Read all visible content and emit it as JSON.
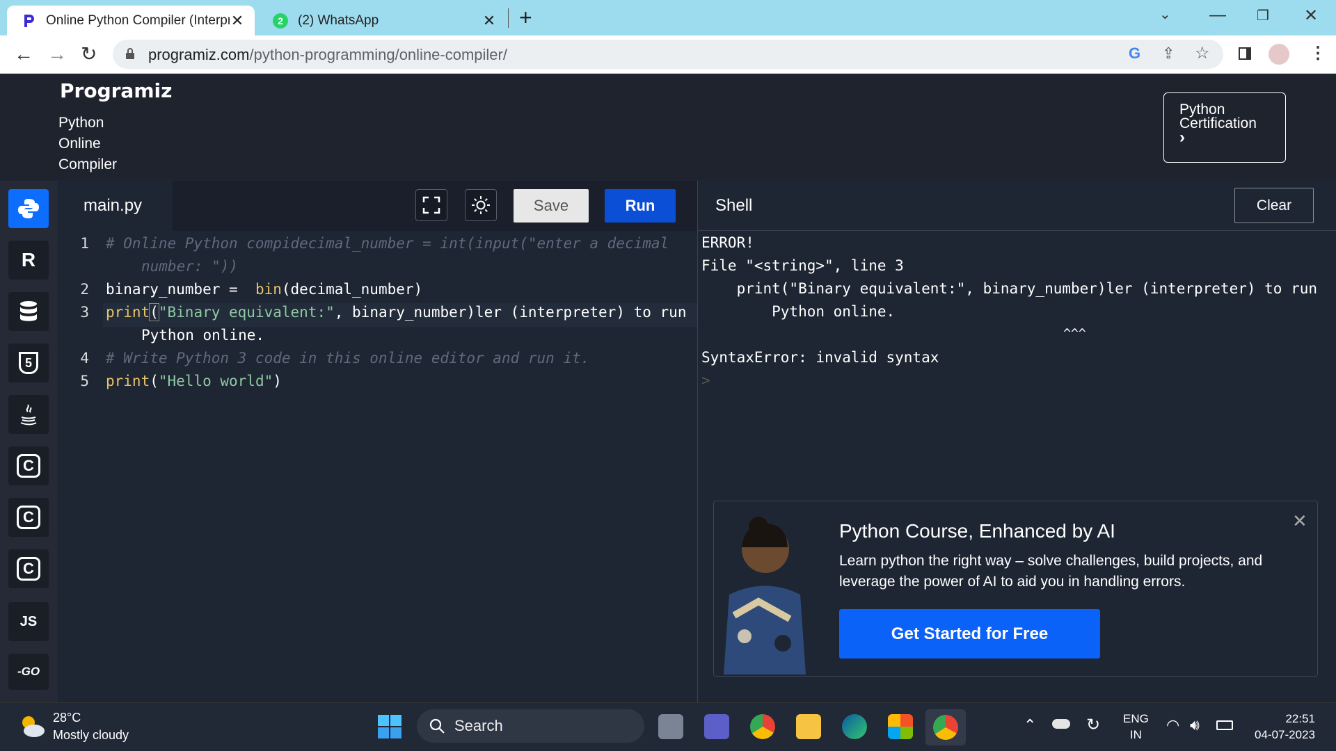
{
  "browser": {
    "tabs": [
      {
        "title": "Online Python Compiler (Interpreter)",
        "active": true,
        "icon": "programiz-icon"
      },
      {
        "title": "(2) WhatsApp",
        "active": false,
        "icon": "whatsapp-icon",
        "badge": "2"
      }
    ],
    "url_host": "programiz.com",
    "url_path": "/python-programming/online-compiler/"
  },
  "header": {
    "logo": "Programiz",
    "subtitle_lines": [
      "Python",
      "Online",
      "Compiler"
    ],
    "cert_line1": "Python",
    "cert_line2": "Certification",
    "cert_chevron": "›"
  },
  "sidebar": {
    "items": [
      {
        "name": "python",
        "label": "",
        "active": true
      },
      {
        "name": "r",
        "label": "R"
      },
      {
        "name": "sql",
        "label": ""
      },
      {
        "name": "html",
        "label": "5"
      },
      {
        "name": "java",
        "label": ""
      },
      {
        "name": "c",
        "label": "C"
      },
      {
        "name": "cpp",
        "label": "C"
      },
      {
        "name": "csharp",
        "label": "C"
      },
      {
        "name": "js",
        "label": "JS"
      },
      {
        "name": "go",
        "label": "-GO"
      }
    ]
  },
  "editor": {
    "filename": "main.py",
    "save_label": "Save",
    "run_label": "Run",
    "line_numbers": [
      "1",
      "2",
      "3",
      "4",
      "5"
    ],
    "line1a": "# Online Python compidecimal_number = int(input(\"enter a decimal",
    "line1b": "number: \"))",
    "line2_var": "binary_number =  ",
    "line2_fn": "bin",
    "line2_rest": "(decimal_number)",
    "line3_fn": "print",
    "line3_p1": "(",
    "line3_str": "\"Binary equivalent:\"",
    "line3_rest": ", binary_number)ler (interpreter) to run",
    "line3b": "Python online.",
    "line4": "# Write Python 3 code in this online editor and run it.",
    "line5_fn": "print",
    "line5_p": "(",
    "line5_str": "\"Hello world\"",
    "line5_end": ")"
  },
  "shell": {
    "title": "Shell",
    "clear_label": "Clear",
    "lines": [
      "ERROR!",
      "File \"<string>\", line 3",
      "    print(\"Binary equivalent:\", binary_number)ler (interpreter) to run",
      "        Python online.",
      "                                                ^^^",
      "SyntaxError: invalid syntax",
      ">"
    ]
  },
  "ad": {
    "title": "Python Course, Enhanced by AI",
    "body": "Learn python the right way – solve challenges, build projects, and leverage the power of AI to aid you in handling errors.",
    "button": "Get Started for Free"
  },
  "taskbar": {
    "temp": "28°C",
    "weather": "Mostly cloudy",
    "search": "Search",
    "lang1": "ENG",
    "lang2": "IN",
    "time": "22:51",
    "date": "04-07-2023"
  }
}
